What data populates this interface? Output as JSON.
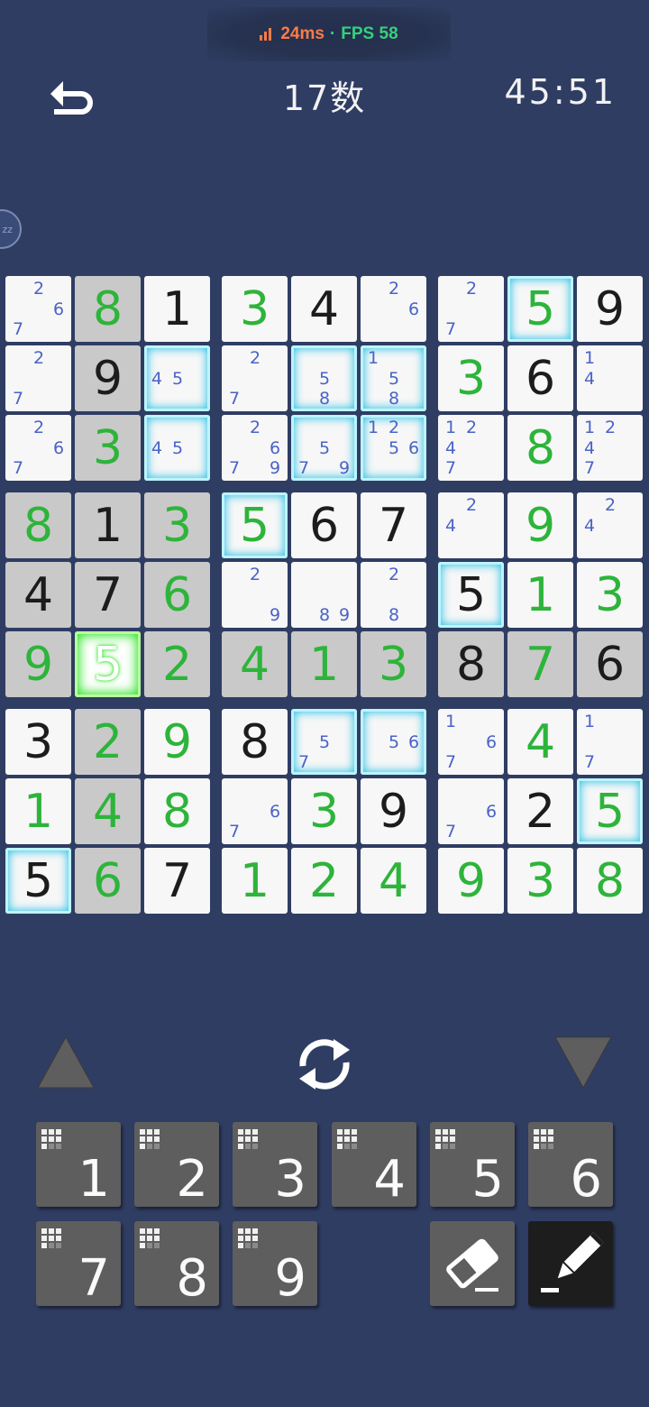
{
  "status": {
    "ping": "24ms",
    "separator": "·",
    "fps": "FPS 58"
  },
  "header": {
    "title": "17数",
    "timer": "45:51"
  },
  "side_badge": {
    "text": "zz"
  },
  "colors": {
    "background": "#2f3d63",
    "given": "#1c1c1c",
    "user": "#2db43a",
    "note": "#4a63c7",
    "glow": "#34c4e6",
    "selected": "#2ee528"
  },
  "board": {
    "values": [
      [
        0,
        8,
        1,
        3,
        4,
        0,
        0,
        5,
        9
      ],
      [
        0,
        9,
        0,
        0,
        0,
        0,
        3,
        6,
        0
      ],
      [
        0,
        3,
        0,
        0,
        0,
        0,
        0,
        8,
        0
      ],
      [
        8,
        1,
        3,
        5,
        6,
        7,
        0,
        9,
        0
      ],
      [
        4,
        7,
        6,
        0,
        0,
        0,
        5,
        1,
        3
      ],
      [
        9,
        5,
        2,
        4,
        1,
        3,
        8,
        7,
        6
      ],
      [
        3,
        2,
        9,
        8,
        0,
        0,
        0,
        4,
        0
      ],
      [
        1,
        4,
        8,
        0,
        3,
        9,
        0,
        2,
        5
      ],
      [
        5,
        6,
        7,
        1,
        2,
        4,
        9,
        3,
        8
      ]
    ],
    "types": [
      "guguggXug",
      "XgXXXXugX",
      "XuXXXXXuX",
      "uguugguuX",
      "gguXXXguu",
      "uuuuuugug",
      "guugXXXuX",
      "uuuXugXgu",
      "guguuuuuu"
    ],
    "highlight": [
      "010000000",
      "010000000",
      "010000000",
      "111000000",
      "111000000",
      "111111111",
      "010000000",
      "010000000",
      "010000000"
    ],
    "glow": [
      "000000010",
      "001011000",
      "001011000",
      "000100000",
      "000000100",
      "000000000",
      "000011000",
      "000000001",
      "100000000"
    ],
    "selected": [
      5,
      1
    ],
    "notes": [
      [
        [
          2,
          6,
          7
        ],
        0,
        0,
        0,
        0,
        [
          2,
          6
        ],
        [
          2,
          7
        ],
        0,
        0
      ],
      [
        [
          2,
          7
        ],
        0,
        [
          4,
          5
        ],
        [
          2,
          7
        ],
        [
          5,
          8
        ],
        [
          1,
          5,
          8
        ],
        0,
        0,
        [
          1,
          4
        ]
      ],
      [
        [
          2,
          6,
          7
        ],
        0,
        [
          4,
          5
        ],
        [
          2,
          6,
          7,
          9
        ],
        [
          5,
          7,
          9
        ],
        [
          1,
          2,
          5,
          6
        ],
        [
          1,
          2,
          4,
          7
        ],
        0,
        [
          1,
          2,
          4,
          7
        ]
      ],
      [
        0,
        0,
        0,
        0,
        0,
        0,
        [
          2,
          4
        ],
        0,
        [
          2,
          4
        ]
      ],
      [
        0,
        0,
        0,
        [
          2,
          9
        ],
        [
          8,
          9
        ],
        [
          2,
          8
        ],
        0,
        0,
        0
      ],
      [
        0,
        0,
        0,
        0,
        0,
        0,
        0,
        0,
        0
      ],
      [
        0,
        0,
        0,
        0,
        [
          5,
          7
        ],
        [
          5,
          6
        ],
        [
          1,
          6,
          7
        ],
        0,
        [
          1,
          7
        ]
      ],
      [
        0,
        0,
        0,
        [
          6,
          7
        ],
        0,
        0,
        [
          6,
          7
        ],
        0,
        0
      ],
      [
        0,
        0,
        0,
        0,
        0,
        0,
        0,
        0,
        0
      ]
    ]
  },
  "controls": {
    "up_icon": "triangle-up-icon",
    "refresh_icon": "refresh-icon",
    "down_icon": "triangle-down-icon"
  },
  "keypad": {
    "keys": [
      "1",
      "2",
      "3",
      "4",
      "5",
      "6",
      "7",
      "8",
      "9"
    ],
    "eraser_icon": "eraser-icon",
    "pencil_icon": "pencil-icon"
  }
}
